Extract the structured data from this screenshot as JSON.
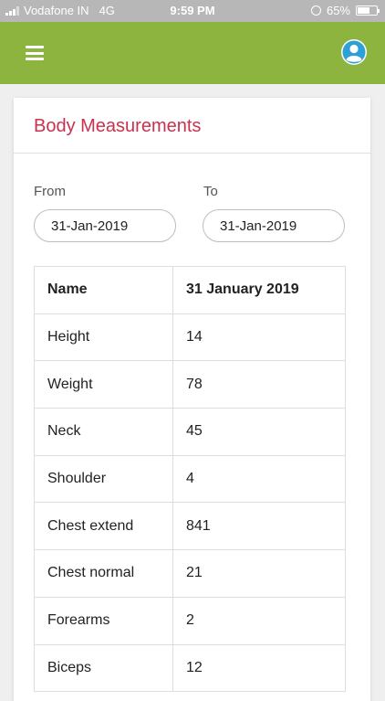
{
  "status": {
    "carrier": "Vodafone IN",
    "network": "4G",
    "time": "9:59 PM",
    "battery": "65%",
    "battery_level": 0.65
  },
  "app_bar": {
    "menu_icon": "hamburger-menu-icon",
    "profile_icon": "user-avatar-icon",
    "accent": "#8db43e"
  },
  "card": {
    "title": "Body Measurements",
    "title_color": "#c8314f"
  },
  "filters": {
    "from_label": "From",
    "from_value": "31-Jan-2019",
    "to_label": "To",
    "to_value": "31-Jan-2019"
  },
  "table": {
    "headers": [
      "Name",
      "31 January 2019"
    ],
    "rows": [
      [
        "Height",
        "14"
      ],
      [
        "Weight",
        "78"
      ],
      [
        "Neck",
        "45"
      ],
      [
        "Shoulder",
        "4"
      ],
      [
        "Chest extend",
        "841"
      ],
      [
        "Chest normal",
        "21"
      ],
      [
        "Forearms",
        "2"
      ],
      [
        "Biceps",
        "12"
      ]
    ]
  }
}
